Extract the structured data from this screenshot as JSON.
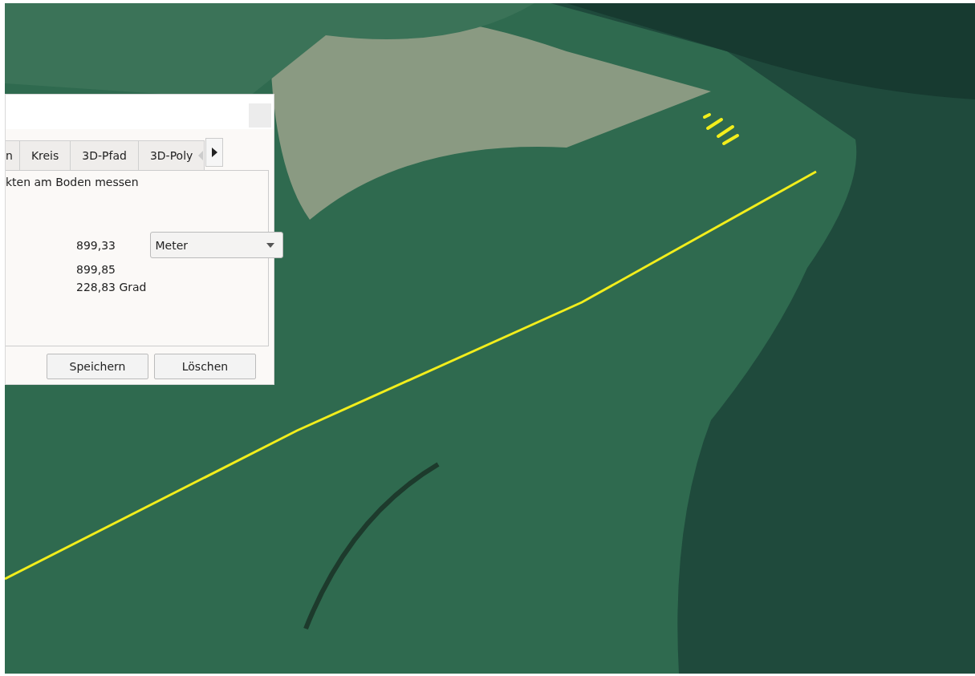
{
  "dialog": {
    "tabs": [
      {
        "label": "n",
        "selected": false
      },
      {
        "label": "Kreis",
        "selected": false
      },
      {
        "label": "3D-Pfad",
        "selected": false
      },
      {
        "label": "3D-Poly",
        "selected": false
      }
    ],
    "description": "kten am Boden messen",
    "length": {
      "value": "899,33",
      "unit": "Meter"
    },
    "ground_length": "899,85",
    "heading": "228,83 Grad",
    "buttons": [
      "Speichern",
      "Löschen"
    ]
  }
}
